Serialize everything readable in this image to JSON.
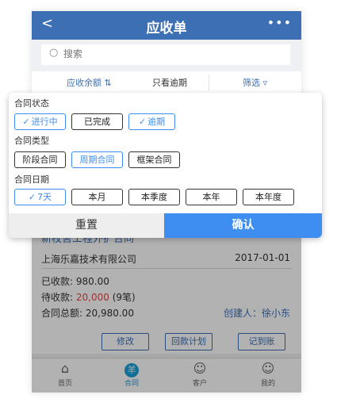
{
  "nav": {
    "back": "<",
    "title": "应收单",
    "more": "•••"
  },
  "search": {
    "placeholder": "搜索"
  },
  "filterbar": {
    "item1": "应收余额 ⇅",
    "item2": "只看逾期",
    "item3": "筛选 ▿"
  },
  "content": {
    "title": "新校舍工程外扩合同",
    "company": "上海乐嘉技术有限公司",
    "date": "2017-01-01",
    "received_label": "已收款:",
    "received_value": "980.00",
    "pending_label": "待收款:",
    "pending_value": "20,000",
    "pending_count": "(9笔)",
    "total_label": "合同总额:",
    "total_value": "20,980.00",
    "creator": "创建人：徐小东",
    "actions": [
      "修改",
      "回款计划",
      "记到账"
    ]
  },
  "tabbar": [
    {
      "label": "首页",
      "icon": "home-icon",
      "glyph": "⌂"
    },
    {
      "label": "合同",
      "icon": "contract-icon",
      "glyph": "羊"
    },
    {
      "label": "客户",
      "icon": "customers-icon",
      "glyph": "☺"
    },
    {
      "label": "我的",
      "icon": "profile-icon",
      "glyph": "☺"
    }
  ],
  "filter_panel": {
    "status": {
      "title": "合同状态",
      "options": [
        {
          "label": "进行中",
          "selected": true
        },
        {
          "label": "已完成",
          "selected": false
        },
        {
          "label": "逾期",
          "selected": true
        }
      ]
    },
    "type": {
      "title": "合同类型",
      "options": [
        {
          "label": "阶段合同",
          "selected": false
        },
        {
          "label": "周期合同",
          "selected": true
        },
        {
          "label": "框架合同",
          "selected": false
        }
      ]
    },
    "date": {
      "title": "合同日期",
      "options": [
        {
          "label": "7天",
          "selected": true
        },
        {
          "label": "本月",
          "selected": false
        },
        {
          "label": "本季度",
          "selected": false
        },
        {
          "label": "本年",
          "selected": false
        },
        {
          "label": "本年度",
          "selected": false
        }
      ]
    },
    "reset": "重置",
    "confirm": "确认"
  },
  "colors": {
    "primary": "#3d6fb4",
    "accent": "#3d8ef0",
    "tab_active": "#1aa0d8",
    "pending": "#e64545"
  }
}
